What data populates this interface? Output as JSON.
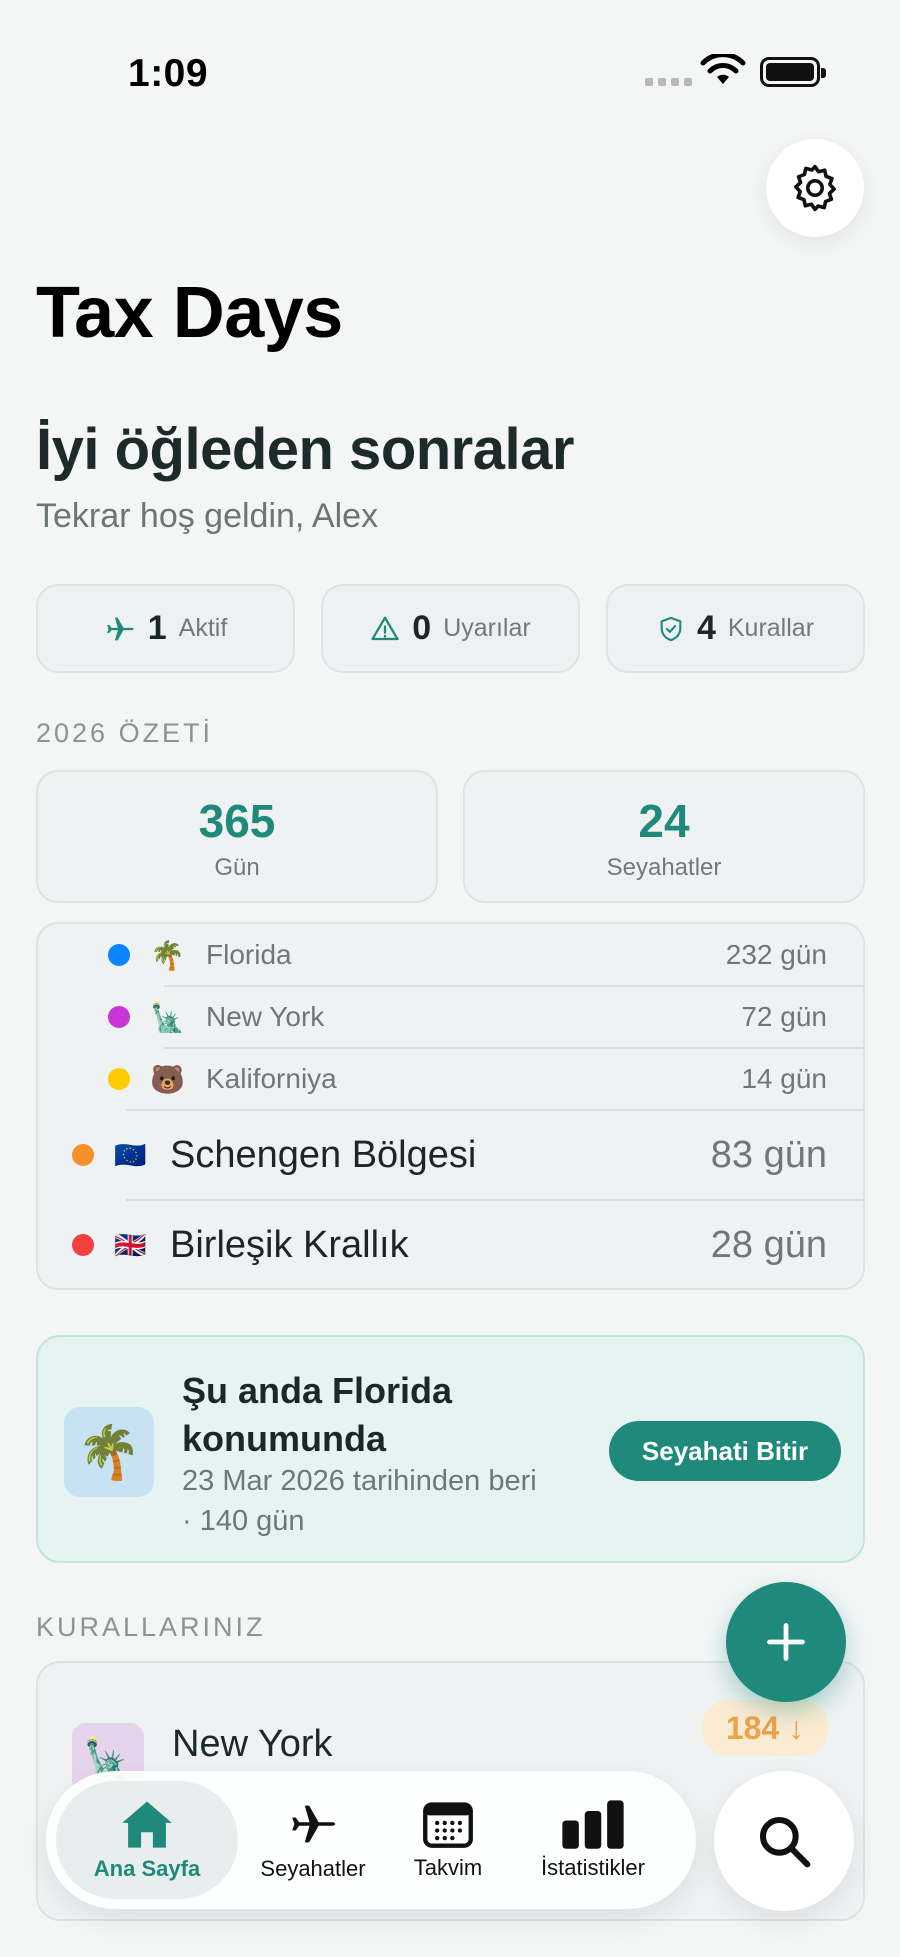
{
  "status_bar": {
    "time": "1:09"
  },
  "app_title": "Tax Days",
  "greeting": "İyi öğleden sonralar",
  "subgreeting": "Tekrar hoş geldin, Alex",
  "chips": [
    {
      "icon": "airplane-icon",
      "value": "1",
      "label": "Aktif"
    },
    {
      "icon": "warning-icon",
      "value": "0",
      "label": "Uyarılar"
    },
    {
      "icon": "shield-check-icon",
      "value": "4",
      "label": "Kurallar"
    }
  ],
  "summary": {
    "section_title": "2026 ÖZETİ",
    "days_value": "365",
    "days_label": "Gün",
    "trips_value": "24",
    "trips_label": "Seyahatler"
  },
  "regions": [
    {
      "name": "Florida",
      "days": "232 gün",
      "color": "#0a84ff",
      "emoji": "🌴"
    },
    {
      "name": "New York",
      "days": "72 gün",
      "color": "#c836d8",
      "emoji": "🗽"
    },
    {
      "name": "Kaliforniya",
      "days": "14 gün",
      "color": "#ffcc00",
      "emoji": "🐻"
    },
    {
      "name": "Schengen Bölgesi",
      "days": "83 gün",
      "color": "#f5902a",
      "emoji": "🇪🇺"
    },
    {
      "name": "Birleşik Krallık",
      "days": "28 gün",
      "color": "#f2403f",
      "emoji": "🇬🇧"
    }
  ],
  "current": {
    "emoji": "🌴",
    "title": "Şu anda Florida konumunda",
    "subtitle": "23 Mar 2026 tarihinden beri · 140 gün",
    "button": "Seyahati Bitir"
  },
  "rules": {
    "section_title": "KURALLARINIZ",
    "first": {
      "emoji": "🗽",
      "name": "New York",
      "badge": "184 ↓"
    }
  },
  "tabs": [
    {
      "label": "Ana Sayfa",
      "icon": "house-icon",
      "active": true
    },
    {
      "label": "Seyahatler",
      "icon": "airplane-icon"
    },
    {
      "label": "Takvim",
      "icon": "calendar-icon"
    },
    {
      "label": "İstatistikler",
      "icon": "bar-chart-icon"
    }
  ],
  "colors": {
    "accent": "#1f8a7b",
    "background": "#f4f6f6"
  }
}
